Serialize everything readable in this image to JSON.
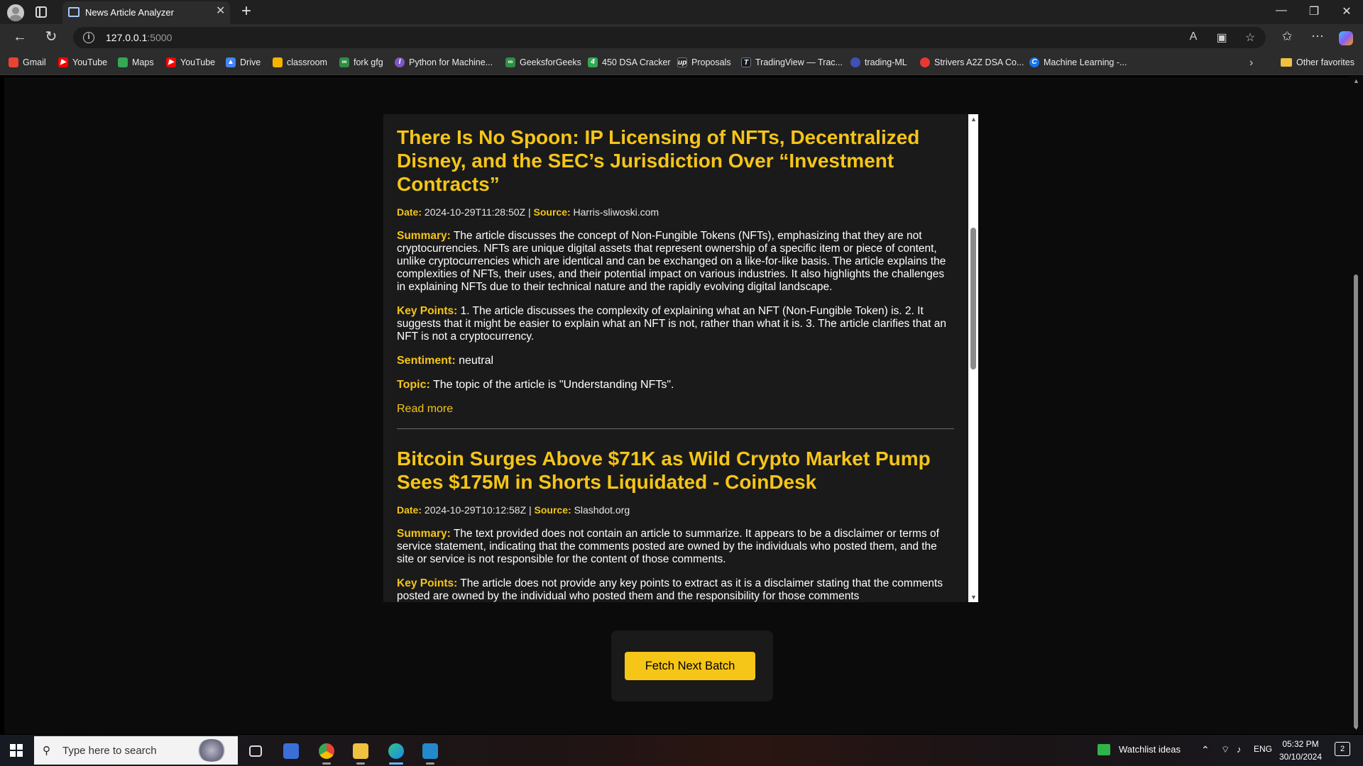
{
  "browser": {
    "tab_title": "News Article Analyzer",
    "url_host": "127.0.0.1",
    "url_port": ":5000",
    "bookmarks": [
      {
        "label": "Gmail",
        "color": "#ea4335"
      },
      {
        "label": "YouTube",
        "color": "#ff0000"
      },
      {
        "label": "Maps",
        "color": "#34a853"
      },
      {
        "label": "YouTube",
        "color": "#ff0000"
      },
      {
        "label": "Drive",
        "color": "#4285f4"
      },
      {
        "label": "classroom",
        "color": "#f4b400"
      },
      {
        "label": "fork gfg",
        "color": "#2f8d46"
      },
      {
        "label": "Python for Machine...",
        "color": "#7e57c2"
      },
      {
        "label": "GeeksforGeeks",
        "color": "#2f8d46"
      },
      {
        "label": "450 DSA Cracker",
        "color": "#34a853"
      },
      {
        "label": "Proposals",
        "color": "#222222"
      },
      {
        "label": "TradingView — Trac...",
        "color": "#131722"
      },
      {
        "label": "trading-ML",
        "color": "#3f51b5"
      },
      {
        "label": "Strivers A2Z DSA Co...",
        "color": "#e53935"
      },
      {
        "label": "Machine Learning -...",
        "color": "#1a73e8"
      }
    ],
    "other_favorites": "Other favorites"
  },
  "articles": [
    {
      "title": "There Is No Spoon: IP Licensing of NFTs, Decentralized Disney, and the SEC’s Jurisdiction Over “Investment Contracts”",
      "date_label": "Date:",
      "date": "2024-10-29T11:28:50Z",
      "separator": "|",
      "source_label": "Source:",
      "source": "Harris-sliwoski.com",
      "summary_label": "Summary:",
      "summary": "The article discusses the concept of Non-Fungible Tokens (NFTs), emphasizing that they are not cryptocurrencies. NFTs are unique digital assets that represent ownership of a specific item or piece of content, unlike cryptocurrencies which are identical and can be exchanged on a like-for-like basis. The article explains the complexities of NFTs, their uses, and their potential impact on various industries. It also highlights the challenges in explaining NFTs due to their technical nature and the rapidly evolving digital landscape.",
      "key_points_label": "Key Points:",
      "key_points": "1. The article discusses the complexity of explaining what an NFT (Non-Fungible Token) is. 2. It suggests that it might be easier to explain what an NFT is not, rather than what it is. 3. The article clarifies that an NFT is not a cryptocurrency.",
      "sentiment_label": "Sentiment:",
      "sentiment": "neutral",
      "topic_label": "Topic:",
      "topic": "The topic of the article is \"Understanding NFTs\".",
      "read_more": "Read more"
    },
    {
      "title": "Bitcoin Surges Above $71K as Wild Crypto Market Pump Sees $175M in Shorts Liquidated - CoinDesk",
      "date_label": "Date:",
      "date": "2024-10-29T10:12:58Z",
      "separator": "|",
      "source_label": "Source:",
      "source": "Slashdot.org",
      "summary_label": "Summary:",
      "summary": "The text provided does not contain an article to summarize. It appears to be a disclaimer or terms of service statement, indicating that the comments posted are owned by the individuals who posted them, and the site or service is not responsible for the content of those comments.",
      "key_points_label": "Key Points:",
      "key_points": "The article does not provide any key points to extract as it is a disclaimer stating that the comments posted are owned by the individual who posted them and the responsibility for those comments"
    }
  ],
  "actions": {
    "fetch_label": "Fetch Next Batch"
  },
  "taskbar": {
    "search_placeholder": "Type here to search",
    "watchlist": "Watchlist ideas",
    "language": "ENG",
    "time": "05:32 PM",
    "date": "30/10/2024",
    "notifications": "2"
  },
  "colors": {
    "accent": "#f5c518",
    "panel": "#1a1a1a",
    "page_bg": "#0b0b0b"
  }
}
